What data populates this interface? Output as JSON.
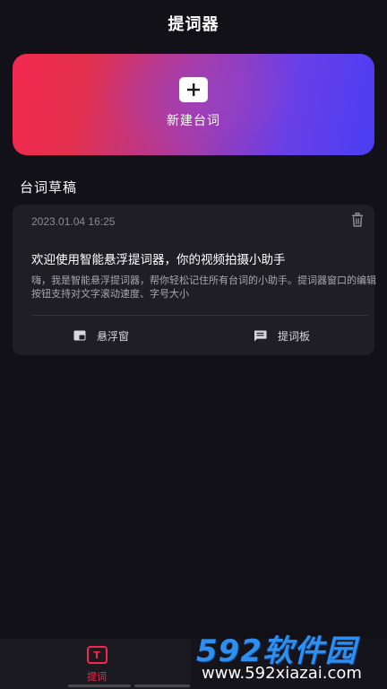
{
  "header": {
    "title": "提词器"
  },
  "new_script": {
    "label": "新建台词"
  },
  "drafts": {
    "section_title": "台词草稿",
    "items": [
      {
        "date": "2023.01.04 16:25",
        "headline": "欢迎使用智能悬浮提词器，你的视频拍摄小助手",
        "body": "嗨，我是智能悬浮提词器，帮你轻松记住所有台词的小助手。提词器窗口的编辑按钮支持对文字滚动速度、字号大小",
        "actions": {
          "float_window": "悬浮窗",
          "prompter_board": "提词板"
        }
      }
    ]
  },
  "bottom_nav": {
    "items": [
      {
        "label": "提词",
        "icon_text": "T",
        "active": true
      }
    ]
  },
  "watermark": {
    "brand": "592软件园",
    "url": "www.592xiazai.com"
  },
  "colors": {
    "background": "#121117",
    "card": "#1f1e25",
    "accent": "#f2284f",
    "gradient_start": "#f2284f",
    "gradient_end": "#4a3ef3",
    "watermark_blue": "#2e8ff0"
  }
}
